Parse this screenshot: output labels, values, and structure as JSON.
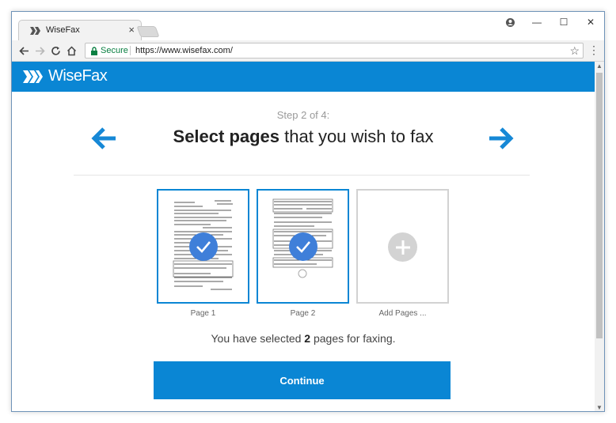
{
  "browser": {
    "tab_title": "WiseFax",
    "tab_close": "×",
    "secure_label": "Secure",
    "url": "https://www.wisefax.com/",
    "icons": {
      "tab_favicon": "wisefax-chevrons-icon",
      "profile": "person-icon",
      "minimize": "minimize-icon",
      "maximize": "maximize-icon",
      "close": "close-icon",
      "back": "arrow-left-icon",
      "forward": "arrow-right-icon",
      "reload": "reload-icon",
      "home": "home-icon",
      "lock": "lock-icon",
      "bookmark": "star-icon",
      "menu": "kebab-menu-icon"
    },
    "glyphs": {
      "minimize": "—",
      "maximize": "☐",
      "close": "✕",
      "star": "☆",
      "menu": "⋮",
      "scroll_up": "▲",
      "scroll_down": "▼"
    }
  },
  "app": {
    "brand": "WiseFax",
    "brand_color": "#0a86d4",
    "step_text": "Step 2 of 4:",
    "heading_bold": "Select pages",
    "heading_rest": " that you wish to fax",
    "pages": [
      {
        "label": "Page 1",
        "selected": true
      },
      {
        "label": "Page 2",
        "selected": true
      }
    ],
    "add_label": "Add Pages ...",
    "summary_prefix": "You have selected ",
    "summary_count": "2",
    "summary_suffix": " pages for faxing.",
    "continue_label": "Continue",
    "check_color": "#3f7fd9"
  }
}
